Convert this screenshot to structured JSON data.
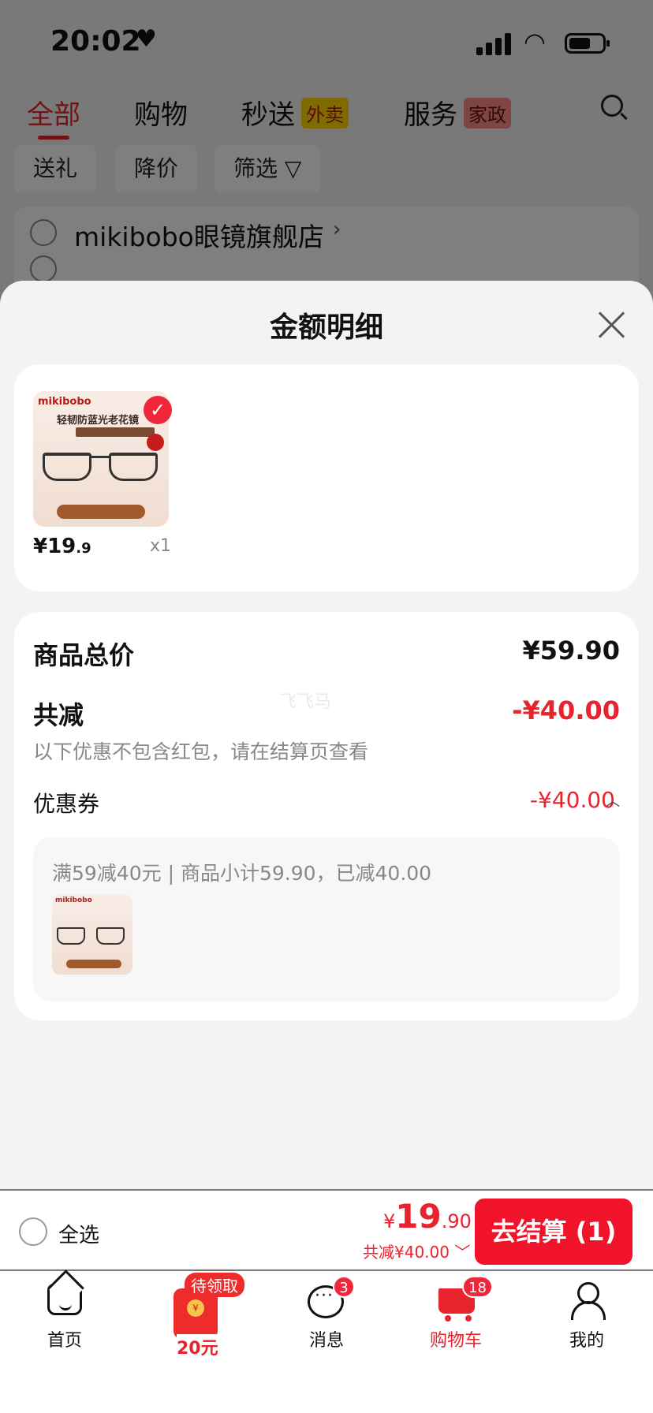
{
  "status": {
    "time": "20:02"
  },
  "top_tabs": [
    {
      "label": "全部"
    },
    {
      "label": "购物"
    },
    {
      "label": "秒送",
      "tag": "外卖"
    },
    {
      "label": "服务",
      "tag": "家政"
    }
  ],
  "chips": [
    {
      "label": "送礼"
    },
    {
      "label": "降价"
    },
    {
      "label": "筛选"
    }
  ],
  "store": {
    "name": "mikibobo眼镜旗舰店"
  },
  "sheet": {
    "title": "金额明细",
    "product": {
      "brand": "mikibobo",
      "headline": "轻韧防蓝光老花镜",
      "price_int": "¥19",
      "price_dec": ".9",
      "qty": "x1"
    },
    "goods_total_label": "商品总价",
    "goods_total_value": "¥59.90",
    "reduce_label": "共减",
    "reduce_value": "-¥40.00",
    "reduce_note": "以下优惠不包含红包，请在结算页查看",
    "coupon_label": "优惠券",
    "coupon_value": "-¥40.00",
    "coupon_detail": "满59减40元 | 商品小计59.90，已减40.00",
    "watermark": "飞飞马"
  },
  "checkout": {
    "select_all": "全选",
    "yen": "¥",
    "total_int": "19",
    "total_dec": ".90",
    "discount": "共减¥40.00",
    "button": "去结算 (1)"
  },
  "tabbar": {
    "home": "首页",
    "redpacket_badge": "待领取",
    "redpacket_amount": "20元",
    "messages": "消息",
    "messages_badge": "3",
    "cart": "购物车",
    "cart_badge": "18",
    "me": "我的"
  },
  "colors": {
    "accent": "#e8232d",
    "button": "#f0132a"
  }
}
